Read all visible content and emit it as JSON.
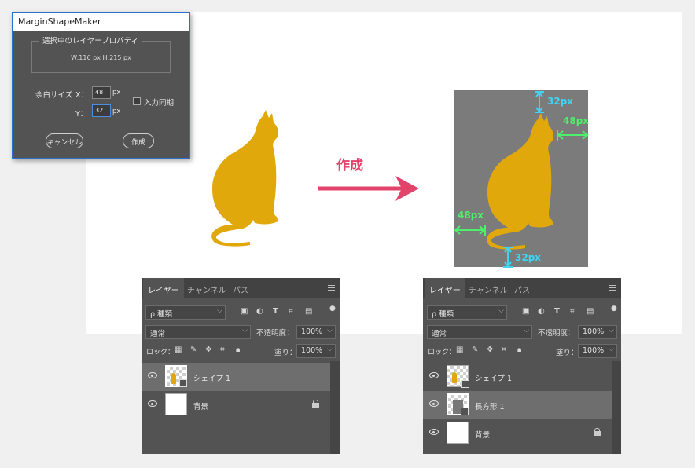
{
  "dialog": {
    "title": "MarginShapeMaker",
    "group_label": "選択中のレイヤープロパティ",
    "size_info": "W:116 px   H:215 px",
    "margin_label": "余白サイズ",
    "x_label": "X：",
    "y_label": "Y：",
    "x_value": "48",
    "y_value": "32",
    "unit": "px",
    "sync_label": "入力同期",
    "cancel_label": "キャンセル",
    "create_label": "作成"
  },
  "illustration": {
    "arrow_label": "作成",
    "top_margin": "32px",
    "bottom_margin": "32px",
    "left_margin": "48px",
    "right_margin": "48px",
    "colors": {
      "cat": "#e0a80b",
      "arrow": "#e2436b",
      "margin_y": "#3fd4f0",
      "margin_x": "#4df06a",
      "shape_bg": "#7b7b7b"
    }
  },
  "panel_before": {
    "tabs": [
      "レイヤー",
      "チャンネル",
      "パス"
    ],
    "filter_label": "ρ 種類",
    "blend_mode": "通常",
    "opacity_label": "不透明度：",
    "opacity_value": "100%",
    "lock_label": "ロック：",
    "fill_label": "塗り：",
    "fill_value": "100%",
    "layers": [
      {
        "name": "シェイプ 1",
        "selected": true,
        "thumb": "shape"
      },
      {
        "name": "背景",
        "selected": false,
        "thumb": "white",
        "locked": true
      }
    ]
  },
  "panel_after": {
    "tabs": [
      "レイヤー",
      "チャンネル",
      "パス"
    ],
    "filter_label": "ρ 種類",
    "blend_mode": "通常",
    "opacity_label": "不透明度：",
    "opacity_value": "100%",
    "lock_label": "ロック：",
    "fill_label": "塗り：",
    "fill_value": "100%",
    "layers": [
      {
        "name": "シェイプ 1",
        "selected": false,
        "thumb": "shape"
      },
      {
        "name": "長方形 1",
        "selected": true,
        "thumb": "rect"
      },
      {
        "name": "背景",
        "selected": false,
        "thumb": "white",
        "locked": true
      }
    ]
  }
}
